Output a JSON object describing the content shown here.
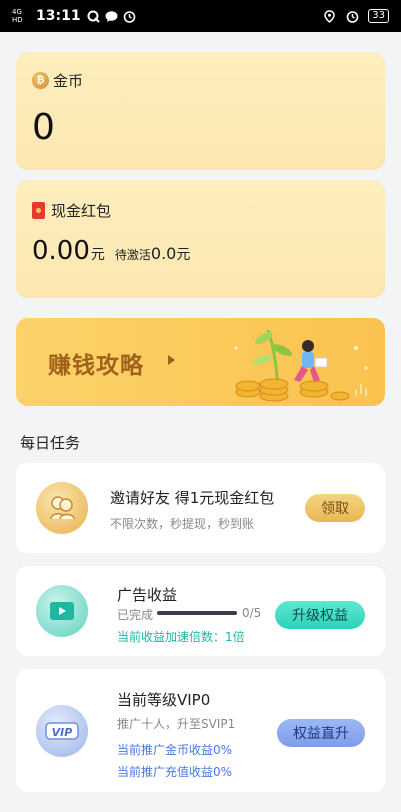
{
  "status_bar": {
    "network": "4G HD",
    "time": "13:11",
    "battery": "33"
  },
  "coins": {
    "label": "金币",
    "value": "0",
    "icon": "coin-icon"
  },
  "red_packet": {
    "label": "现金红包",
    "amount": "0.00",
    "unit": "元",
    "pending_label": "待激活",
    "pending_amount": "0.0",
    "pending_unit": "元"
  },
  "banner": {
    "title": "赚钱攻略"
  },
  "daily_tasks": {
    "title": "每日任务",
    "invite": {
      "title": "邀请好友 得1元现金红包",
      "subtitle": "不限次数，秒提现，秒到账",
      "button": "领取"
    },
    "ad": {
      "title": "广告收益",
      "status": "已完成",
      "progress_text": "0/5",
      "progress": 0,
      "multiplier": "当前收益加速倍数：1倍",
      "button": "升级权益"
    },
    "vip": {
      "title": "当前等级VIP0",
      "subtitle": "推广十人，升至SVIP1",
      "coin_bonus": "当前推广金币收益0%",
      "recharge_bonus": "当前推广充值收益0%",
      "button": "权益直升",
      "icon_text": "VIP"
    }
  },
  "colors": {
    "gold_card": "#fdeebe",
    "banner": "#fbc24f",
    "teal": "#1db7a3",
    "blue": "#4a77e0"
  }
}
